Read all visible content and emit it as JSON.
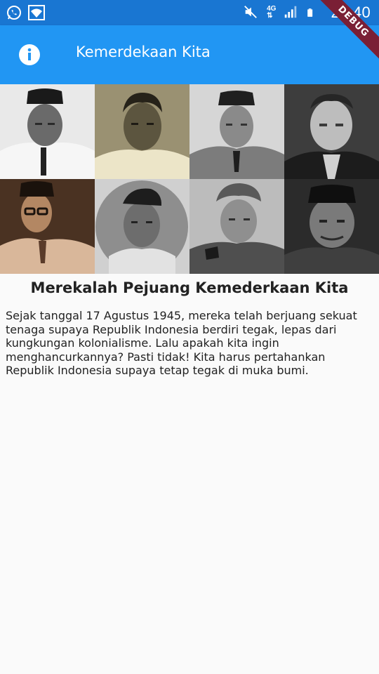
{
  "status_bar": {
    "time": "21:40",
    "network_label": "4G",
    "icons": [
      "whatsapp-icon",
      "wifi-icon",
      "mute-icon",
      "network-4g-icon",
      "signal-icon",
      "battery-icon"
    ]
  },
  "app_bar": {
    "title": "Kemerdekaan Kita",
    "info_icon": "info-icon",
    "color": "#2196f3"
  },
  "debug_banner": "DEBUG",
  "photos": [
    {
      "name": "portrait-1",
      "tone": "bw"
    },
    {
      "name": "portrait-2",
      "tone": "sepia-light"
    },
    {
      "name": "portrait-3",
      "tone": "bw"
    },
    {
      "name": "portrait-4",
      "tone": "bw"
    },
    {
      "name": "portrait-5",
      "tone": "sepia"
    },
    {
      "name": "portrait-6",
      "tone": "bw"
    },
    {
      "name": "portrait-7",
      "tone": "bw"
    },
    {
      "name": "portrait-8",
      "tone": "bw-dark"
    }
  ],
  "content": {
    "heading": "Merekalah Pejuang Kemederkaan Kita",
    "paragraph": "Sejak tanggal 17 Agustus 1945, mereka telah berjuang sekuat tenaga supaya Republik Indonesia berdiri tegak, lepas dari kungkungan kolonialisme. Lalu apakah kita ingin menghancurkannya? Pasti tidak! Kita harus pertahankan Republik Indonesia supaya tetap tegak di muka bumi."
  }
}
